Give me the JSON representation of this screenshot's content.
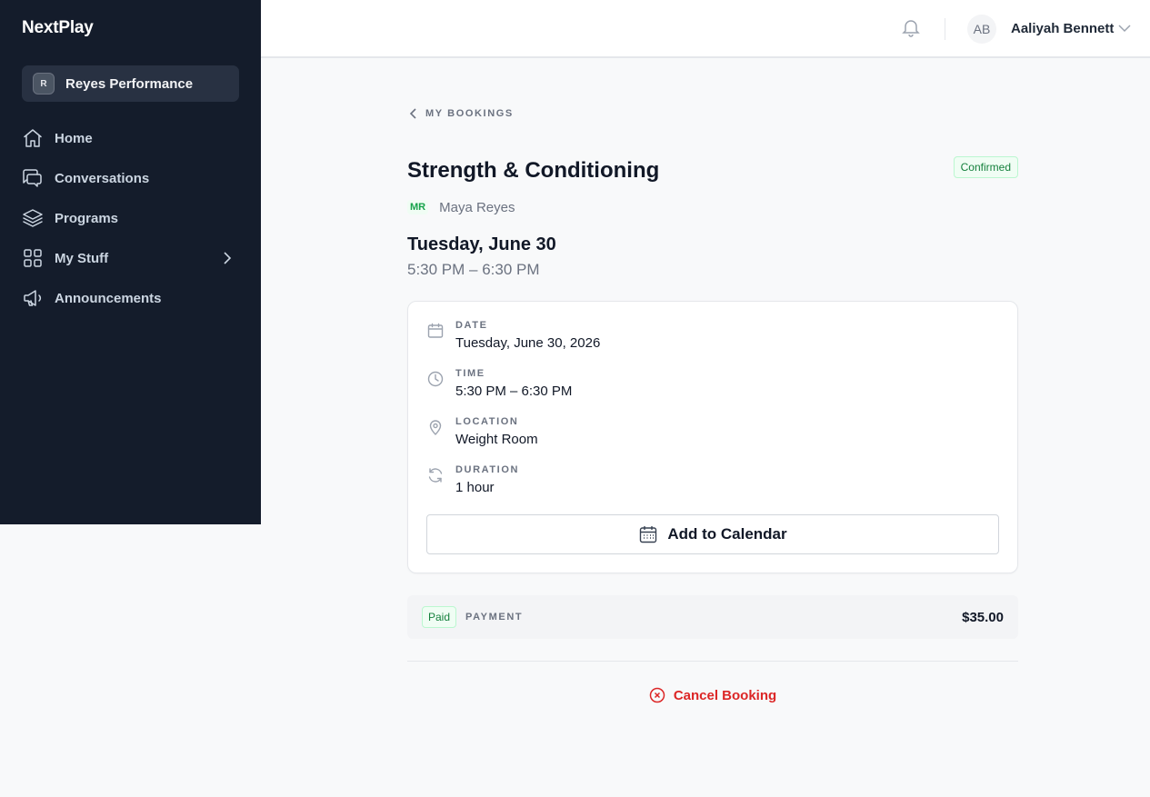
{
  "app": {
    "brand": "NextPlay"
  },
  "sidebar": {
    "org": {
      "initial": "R",
      "name": "Reyes Performance"
    },
    "items": [
      {
        "label": "Home",
        "icon": "home-icon"
      },
      {
        "label": "Conversations",
        "icon": "chat-icon"
      },
      {
        "label": "Programs",
        "icon": "layers-icon"
      },
      {
        "label": "My Stuff",
        "icon": "grid-icon"
      },
      {
        "label": "Announcements",
        "icon": "megaphone-icon"
      }
    ]
  },
  "header": {
    "user_initials": "AB",
    "user_name": "Aaliyah Bennett"
  },
  "booking": {
    "back_label": "MY BOOKINGS",
    "title": "Strength & Conditioning",
    "status": "Confirmed",
    "coach_initials": "MR",
    "coach_name": "Maya Reyes",
    "date_heading": "Tuesday, June 30",
    "time_heading": "5:30 PM – 6:30 PM",
    "details": {
      "date": {
        "label": "DATE",
        "value": "Tuesday, June 30, 2026"
      },
      "time": {
        "label": "TIME",
        "value": "5:30 PM – 6:30 PM"
      },
      "location": {
        "label": "LOCATION",
        "value": "Weight Room"
      },
      "duration": {
        "label": "DURATION",
        "value": "1 hour"
      }
    },
    "add_to_calendar_label": "Add to Calendar",
    "payment": {
      "status": "Paid",
      "label": "PAYMENT",
      "amount": "$35.00"
    },
    "cancel_label": "Cancel Booking"
  },
  "colors": {
    "sidebar_bg": "#141c2b",
    "success": "#15803d",
    "danger": "#dc2626"
  }
}
